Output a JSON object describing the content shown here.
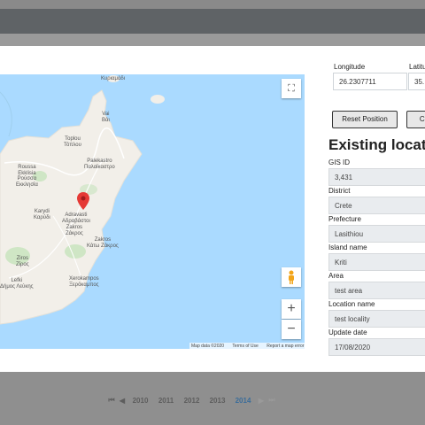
{
  "pagination": {
    "first_icon": "first-page-icon",
    "prev_icon": "previous-page-icon",
    "pages": [
      "2010",
      "2011",
      "2012",
      "2013",
      "2014"
    ],
    "active_page": "2014",
    "next_icon": "next-page-icon",
    "last_icon": "last-page-icon"
  },
  "map": {
    "places": [
      {
        "name": "Κυριαμάδι"
      },
      {
        "name": "Vai\nΒάι"
      },
      {
        "name": "Toplou\nΤόπλου"
      },
      {
        "name": "Palekastro\nΠαλαίκαστρο"
      },
      {
        "name": "Roussa\nEkklisia\nΡούσσα\nΕκκλησία"
      },
      {
        "name": "Karydi\nΚαρύδι"
      },
      {
        "name": "Adravasti\nΑδραβάστοι"
      },
      {
        "name": "Zakros\nΖάκρος"
      },
      {
        "name": "Zakros\nΚάτω Ζάκρος"
      },
      {
        "name": "Ziros\nΖίρος"
      },
      {
        "name": "Xerokampos\nΞερόκαμπος"
      },
      {
        "name": "Lefki\nΔήμος Λεύκης"
      }
    ],
    "attribution": {
      "data": "Map data ©2020",
      "terms": "Terms of Use",
      "report": "Report a map error"
    },
    "zoom_in": "+",
    "zoom_out": "−"
  },
  "form": {
    "longitude_label": "Longitude",
    "longitude_value": "26.2307711",
    "latitude_label": "Latitu",
    "latitude_value": "35.",
    "reset_button": "Reset Position",
    "cancel_button": "Ca"
  },
  "existing": {
    "heading": "Existing locatio",
    "fields": [
      {
        "label": "GIS ID",
        "value": "3,431"
      },
      {
        "label": "District",
        "value": "Crete"
      },
      {
        "label": "Prefecture",
        "value": "Lasithiou"
      },
      {
        "label": "Island name",
        "value": "Kriti"
      },
      {
        "label": "Area",
        "value": "test area"
      },
      {
        "label": "Location name",
        "value": "test locality"
      },
      {
        "label": "Update date",
        "value": "17/08/2020"
      }
    ]
  },
  "colors": {
    "sea": "#aadaff",
    "land": "#f2efe9",
    "marker": "#e53935",
    "active_page": "#3b6d9a"
  }
}
